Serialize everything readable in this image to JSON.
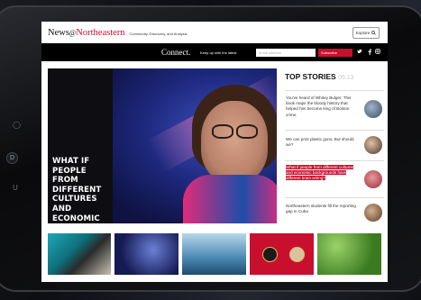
{
  "header": {
    "logo_prefix": "News",
    "logo_at": "@",
    "logo_brand": "Northeastern",
    "tagline": "Community, Discovery, and Analysis",
    "explore_label": "Explore",
    "explore_icon": "search-icon"
  },
  "connect_bar": {
    "title": "Connect.",
    "prompt": "Keep up with the latest",
    "email_placeholder": "email address",
    "subscribe_label": "Subscribe",
    "social_icons": [
      "twitter-icon",
      "facebook-icon",
      "instagram-icon"
    ]
  },
  "hero": {
    "headline": "What if people from different cultures and economic backgrounds have different brain wiring?"
  },
  "top_stories": {
    "title": "TOP STORIES",
    "date": "06.13",
    "items": [
      {
        "text": "You've heard of Whitey Bulger. This book maps the bloody history that helped him become king of Boston crime.",
        "highlighted": false
      },
      {
        "text": "We can print plastic guns. But should we?",
        "highlighted": false
      },
      {
        "text": "What if people from different cultures and economic backgrounds have different brain wiring?",
        "highlighted": true
      },
      {
        "text": "Northeastern students fill the reporting gap in Cuba",
        "highlighted": false
      }
    ]
  },
  "device": {
    "side_buttons": [
      "◯",
      "D",
      "U"
    ]
  },
  "colors": {
    "brand_red": "#c8102e"
  }
}
